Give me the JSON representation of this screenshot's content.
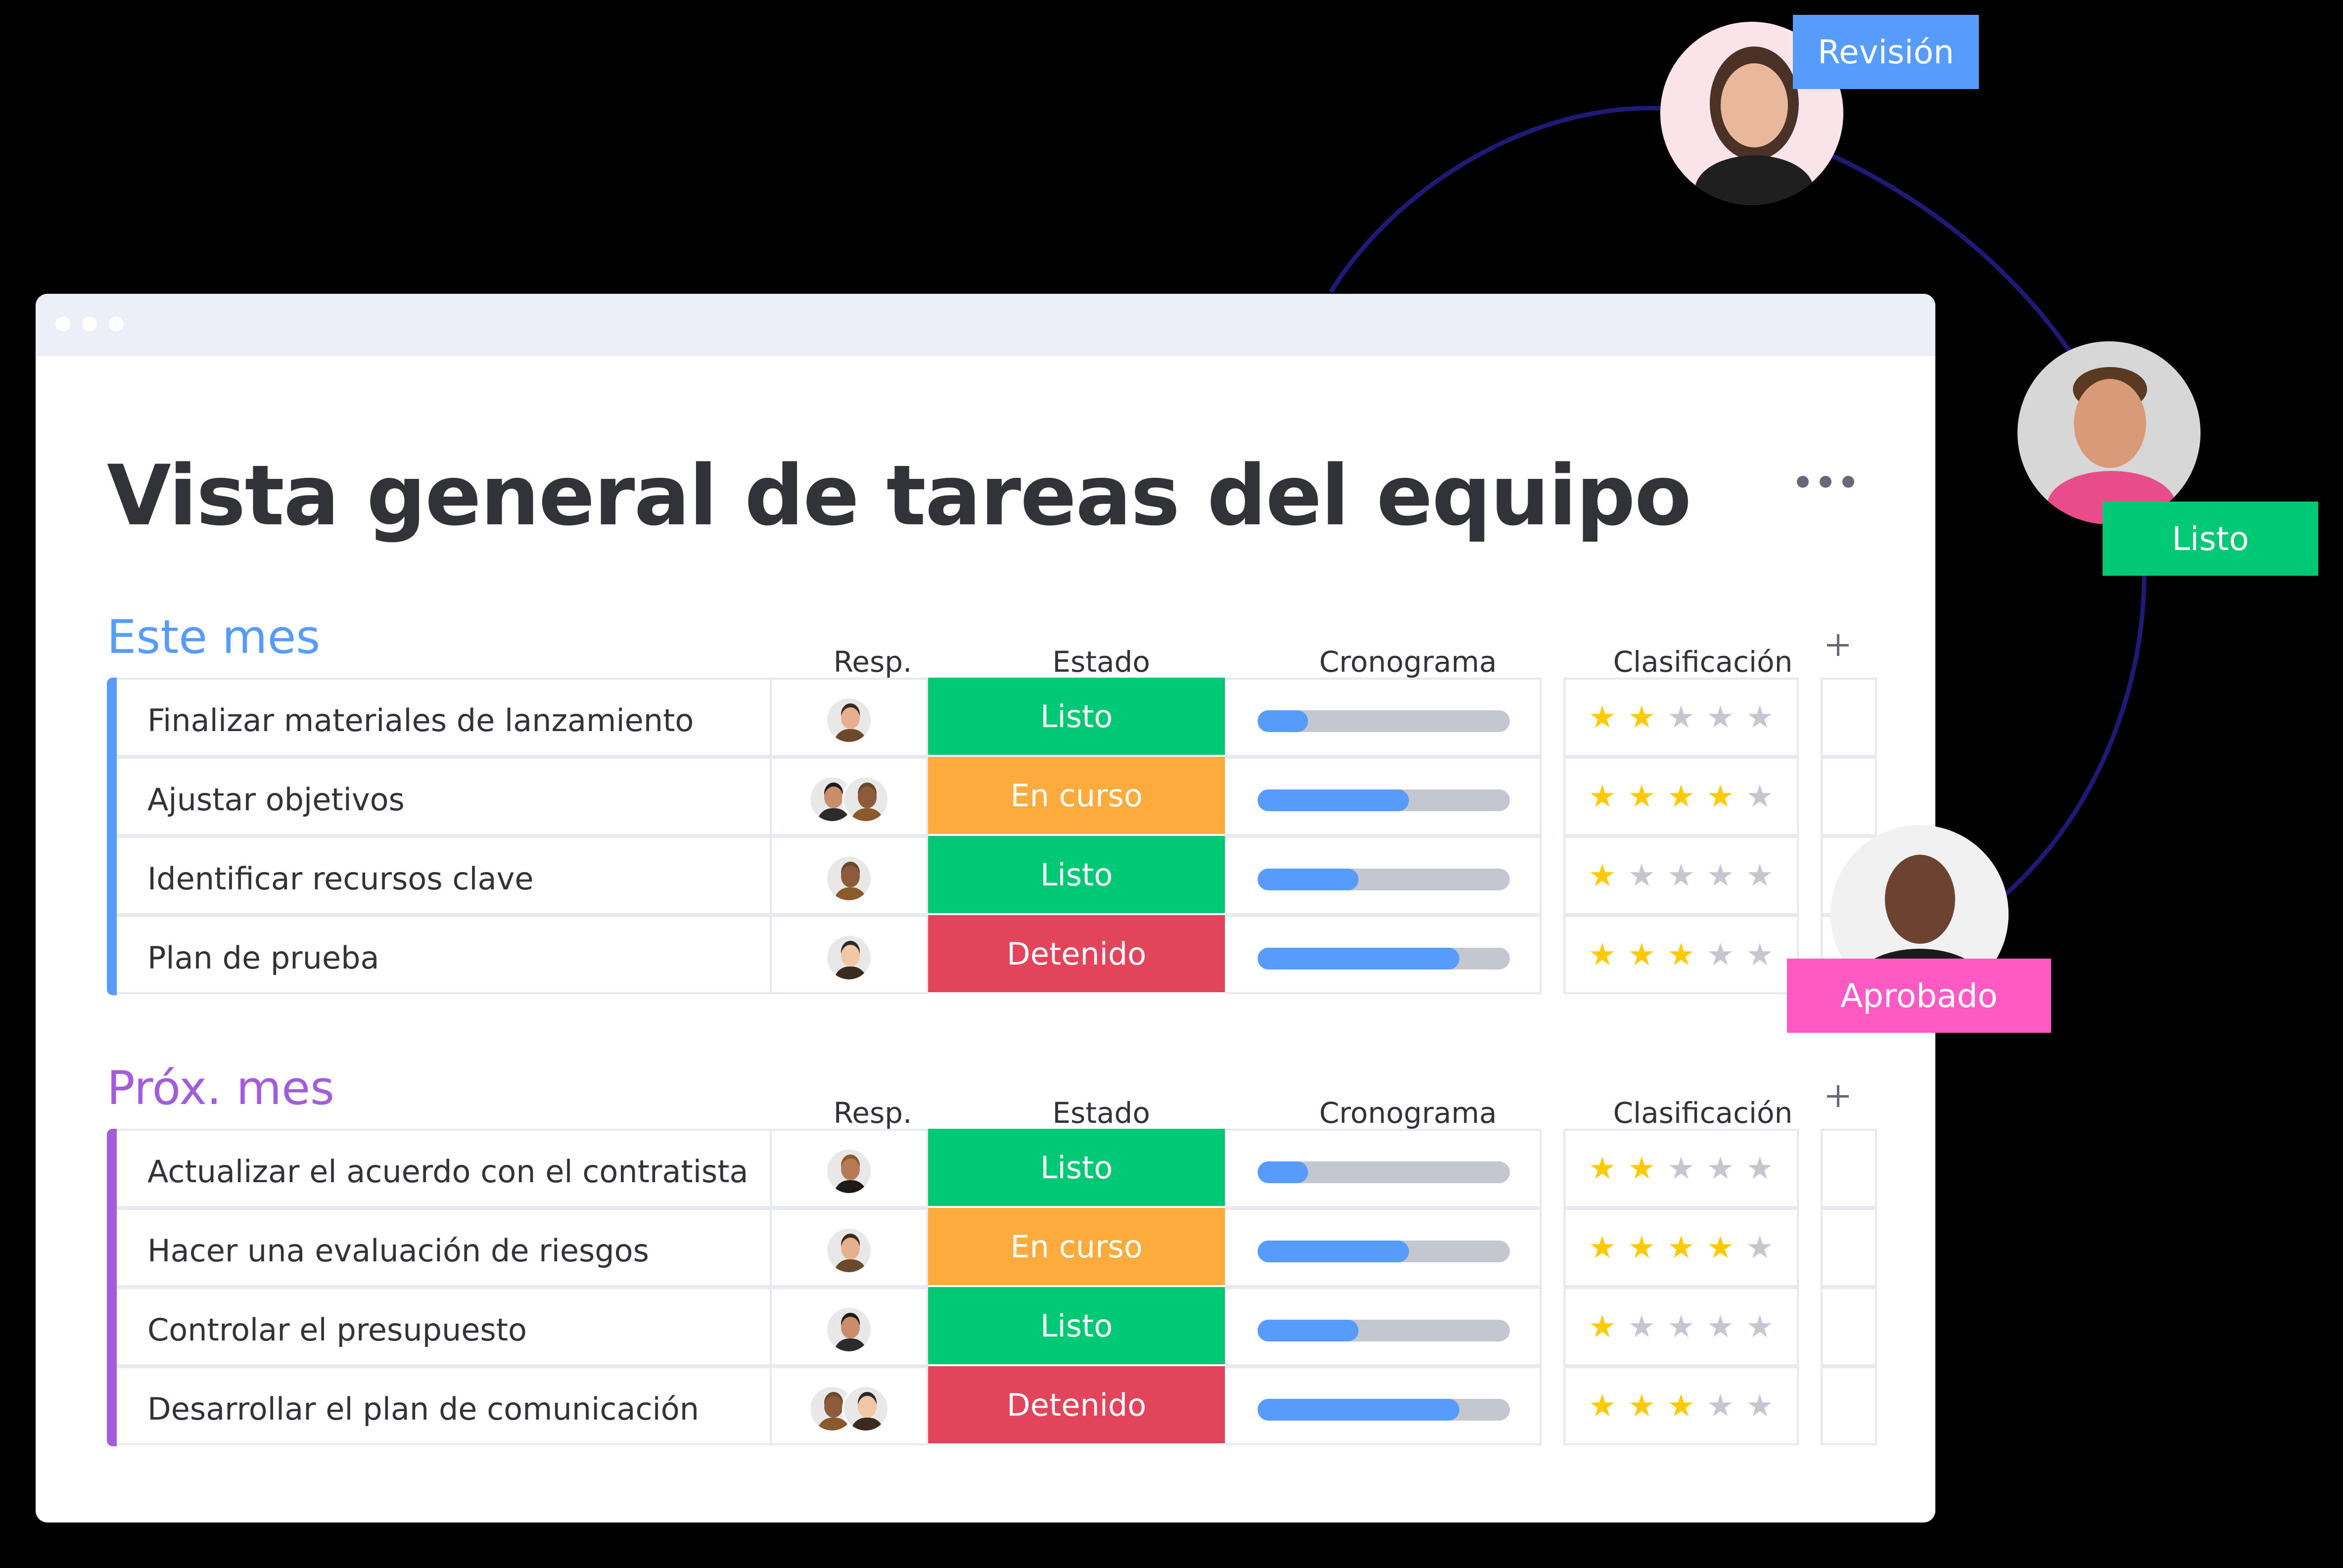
{
  "title": "Vista general de tareas del equipo",
  "colors": {
    "listo": "#00c875",
    "en_curso": "#fdab3d",
    "detenido": "#e2445c",
    "revision": "#579bfc",
    "aprobado": "#ff5ac4",
    "este_mes": "#579bfc",
    "prox_mes": "#a25ddc"
  },
  "columns": {
    "resp": "Resp.",
    "estado": "Estado",
    "cronograma": "Cronograma",
    "clasificacion": "Clasificación"
  },
  "groups": [
    {
      "title": "Este mes",
      "color": "#579bfc",
      "rows": [
        {
          "task": "Finalizar materiales de lanzamiento",
          "status": "Listo",
          "status_color": "#00c875",
          "progress": 0.2,
          "rating": 2,
          "avatars": 1
        },
        {
          "task": "Ajustar objetivos",
          "status": "En curso",
          "status_color": "#fdab3d",
          "progress": 0.6,
          "rating": 4,
          "avatars": 2
        },
        {
          "task": "Identificar recursos clave",
          "status": "Listo",
          "status_color": "#00c875",
          "progress": 0.4,
          "rating": 1,
          "avatars": 1
        },
        {
          "task": "Plan de prueba",
          "status": "Detenido",
          "status_color": "#e2445c",
          "progress": 0.8,
          "rating": 3,
          "avatars": 1
        }
      ]
    },
    {
      "title": "Próx. mes",
      "color": "#a25ddc",
      "rows": [
        {
          "task": "Actualizar el acuerdo con el contratista",
          "status": "Listo",
          "status_color": "#00c875",
          "progress": 0.2,
          "rating": 2,
          "avatars": 1
        },
        {
          "task": "Hacer una evaluación de riesgos",
          "status": "En curso",
          "status_color": "#fdab3d",
          "progress": 0.6,
          "rating": 4,
          "avatars": 1
        },
        {
          "task": "Controlar el presupuesto",
          "status": "Listo",
          "status_color": "#00c875",
          "progress": 0.4,
          "rating": 1,
          "avatars": 1
        },
        {
          "task": "Desarrollar el plan de comunicación",
          "status": "Detenido",
          "status_color": "#e2445c",
          "progress": 0.8,
          "rating": 3,
          "avatars": 2
        }
      ]
    }
  ],
  "floating_tags": {
    "revision": "Revisión",
    "listo": "Listo",
    "aprobado": "Aprobado"
  }
}
